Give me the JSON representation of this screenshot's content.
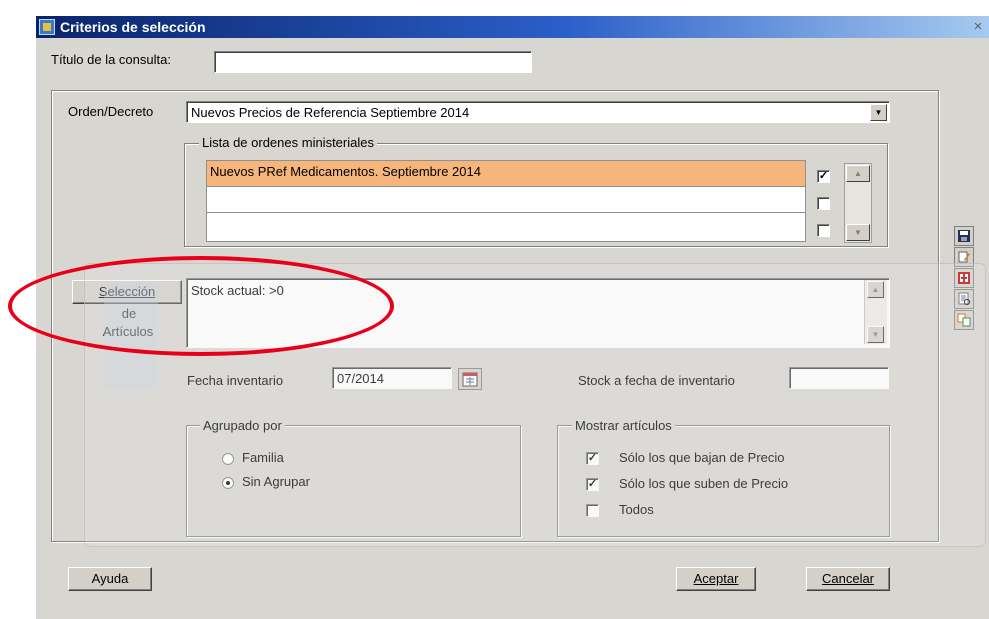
{
  "window": {
    "title": "Criterios de selección",
    "close_glyph": "×"
  },
  "query": {
    "label": "Título de la consulta:",
    "value": ""
  },
  "orden": {
    "label": "Orden/Decreto",
    "selected": "Nuevos Precios de Referencia Septiembre 2014",
    "list_label": "Lista de ordenes ministeriales",
    "rows": [
      {
        "text": "Nuevos PRef Medicamentos. Septiembre 2014",
        "checked": true
      },
      {
        "text": "",
        "checked": false
      },
      {
        "text": "",
        "checked": false
      }
    ]
  },
  "articulos": {
    "button_line1": "Selección",
    "button_line2": "de",
    "button_line3": "Artículos",
    "criteria_text": "Stock actual: >0"
  },
  "fecha": {
    "label": "Fecha inventario",
    "value": "07/2014"
  },
  "stock_fecha": {
    "label": "Stock a fecha de inventario",
    "value": ""
  },
  "agrupado": {
    "legend": "Agrupado por",
    "options": [
      {
        "label": "Familia",
        "selected": false
      },
      {
        "label": "Sin Agrupar",
        "selected": true
      }
    ]
  },
  "mostrar": {
    "legend": "Mostrar artículos",
    "options": [
      {
        "label": "Sólo los que bajan de Precio",
        "checked": true
      },
      {
        "label": "Sólo los que suben de Precio",
        "checked": true
      },
      {
        "label": "Todos",
        "checked": false
      }
    ]
  },
  "buttons": {
    "help": "Ayuda",
    "accept": "Aceptar",
    "cancel": "Cancelar"
  },
  "toolbar": {
    "icons": [
      "save-icon",
      "edit-icon",
      "delete-icon",
      "print-preview-icon",
      "copy-icon"
    ]
  },
  "colors": {
    "selected_row": "#f6b57a",
    "highlight_ellipse": "#e8001a",
    "titlebar": "#0a246a"
  }
}
